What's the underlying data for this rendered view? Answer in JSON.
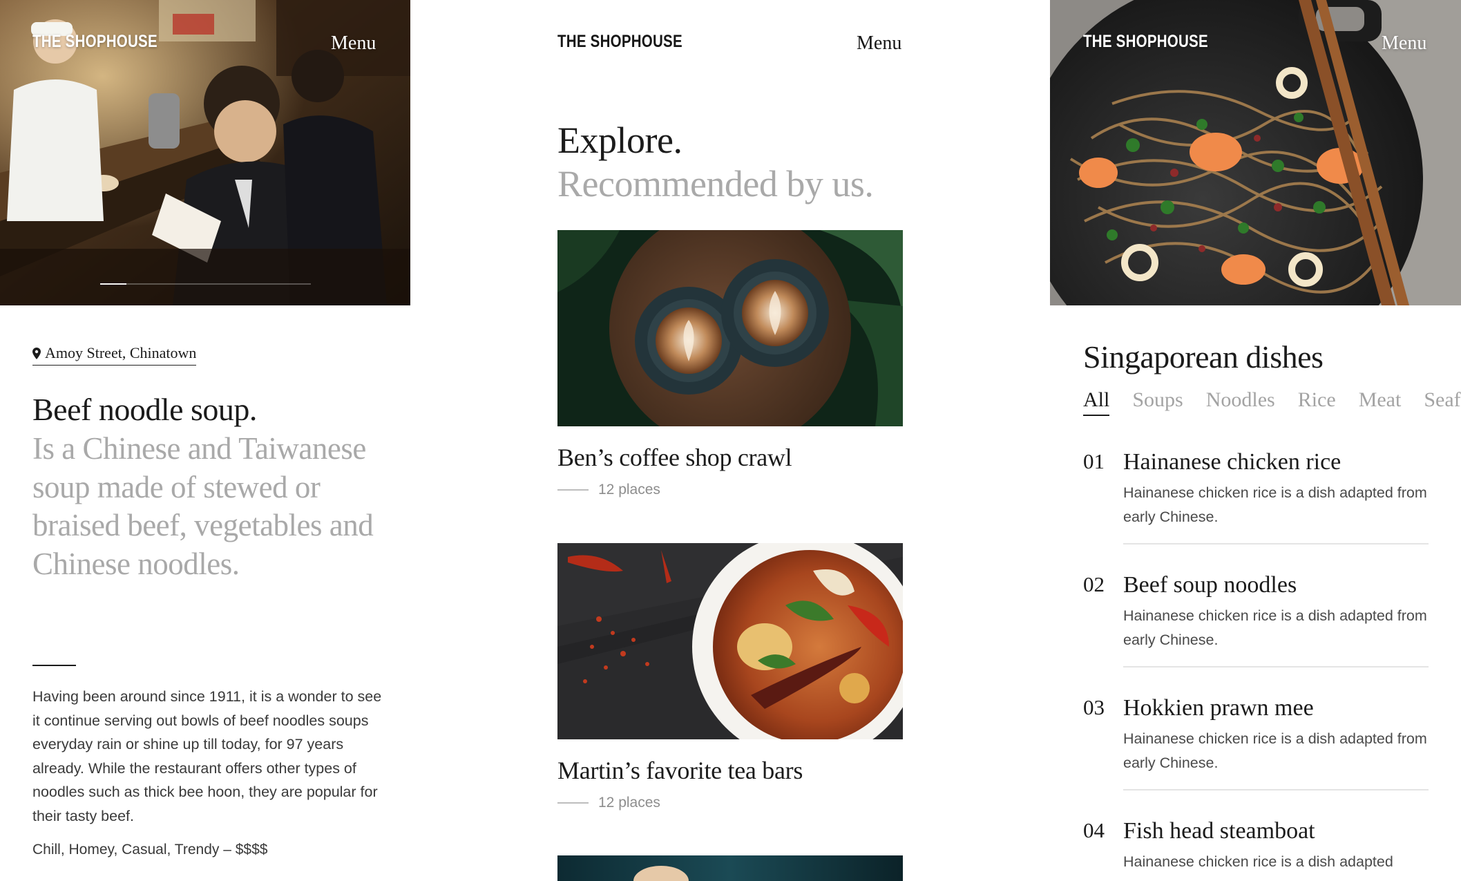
{
  "brand": "THE SHOPHOUSE",
  "menu_label": "Menu",
  "detail": {
    "location": "Amoy Street, Chinatown",
    "title": "Beef noodle soup.",
    "subtitle": "Is a Chinese and Taiwanese soup made of stewed or braised beef, vegetables and Chinese noodles.",
    "body": "Having been around since 1911, it is a wonder to see it continue serving out bowls of beef noodles soups everyday rain or shine up till today, for 97 years already. While the restaurant offers other types of noodles such as thick bee hoon, they are popular for their tasty beef.",
    "tags": "Chill, Homey, Casual, Trendy  –  $$$$"
  },
  "explore": {
    "heading": "Explore.",
    "subheading": "Recommended by us.",
    "cards": [
      {
        "title": "Ben’s coffee shop crawl",
        "meta": "12 places"
      },
      {
        "title": "Martin’s favorite tea bars",
        "meta": "12 places"
      }
    ]
  },
  "dishes": {
    "title": "Singaporean dishes",
    "tabs": [
      "All",
      "Soups",
      "Noodles",
      "Rice",
      "Meat",
      "Seafood"
    ],
    "active_tab": "All",
    "items": [
      {
        "num": "01",
        "name": "Hainanese chicken rice",
        "desc": "Hainanese chicken rice is a dish adapted from early Chinese."
      },
      {
        "num": "02",
        "name": "Beef soup noodles",
        "desc": "Hainanese chicken rice is a dish adapted from early Chinese."
      },
      {
        "num": "03",
        "name": "Hokkien prawn mee",
        "desc": "Hainanese chicken rice is a dish adapted from early Chinese."
      },
      {
        "num": "04",
        "name": "Fish head steamboat",
        "desc": "Hainanese chicken rice is a dish adapted"
      }
    ]
  },
  "colors": {
    "text": "#1b1b1b",
    "muted": "#a9a9a9",
    "divider": "#e4e4e4"
  }
}
